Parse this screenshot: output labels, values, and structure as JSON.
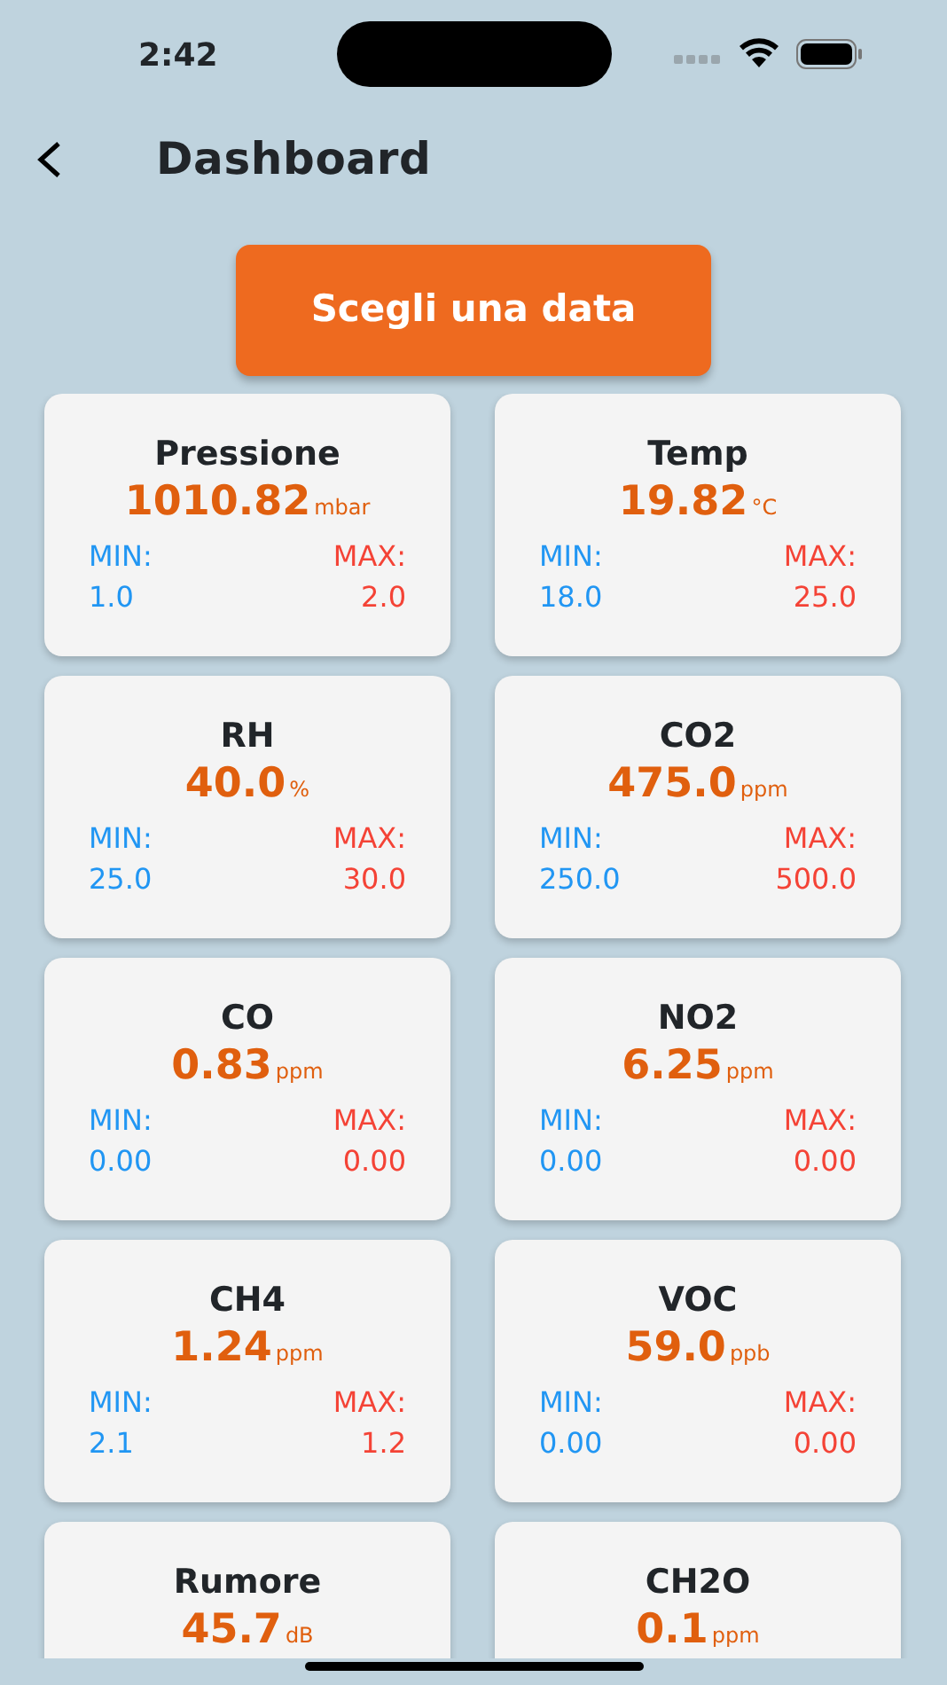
{
  "status_bar": {
    "time": "2:42"
  },
  "header": {
    "title": "Dashboard"
  },
  "date_button": {
    "label": "Scegli una data"
  },
  "sensors": [
    {
      "name": "Pressione",
      "value": "1010.82",
      "unit": "mbar",
      "min_label": "MIN:",
      "max_label": "MAX:",
      "min": "1.0",
      "max": "2.0"
    },
    {
      "name": "Temp",
      "value": "19.82",
      "unit": "°C",
      "min_label": "MIN:",
      "max_label": "MAX:",
      "min": "18.0",
      "max": "25.0"
    },
    {
      "name": "RH",
      "value": "40.0",
      "unit": "%",
      "min_label": "MIN:",
      "max_label": "MAX:",
      "min": "25.0",
      "max": "30.0"
    },
    {
      "name": "CO2",
      "value": "475.0",
      "unit": "ppm",
      "min_label": "MIN:",
      "max_label": "MAX:",
      "min": "250.0",
      "max": "500.0"
    },
    {
      "name": "CO",
      "value": "0.83",
      "unit": "ppm",
      "min_label": "MIN:",
      "max_label": "MAX:",
      "min": "0.00",
      "max": "0.00"
    },
    {
      "name": "NO2",
      "value": "6.25",
      "unit": "ppm",
      "min_label": "MIN:",
      "max_label": "MAX:",
      "min": "0.00",
      "max": "0.00"
    },
    {
      "name": "CH4",
      "value": "1.24",
      "unit": "ppm",
      "min_label": "MIN:",
      "max_label": "MAX:",
      "min": "2.1",
      "max": "1.2"
    },
    {
      "name": "VOC",
      "value": "59.0",
      "unit": "ppb",
      "min_label": "MIN:",
      "max_label": "MAX:",
      "min": "0.00",
      "max": "0.00"
    },
    {
      "name": "Rumore",
      "value": "45.7",
      "unit": "dB"
    },
    {
      "name": "CH2O",
      "value": "0.1",
      "unit": "ppm"
    }
  ]
}
